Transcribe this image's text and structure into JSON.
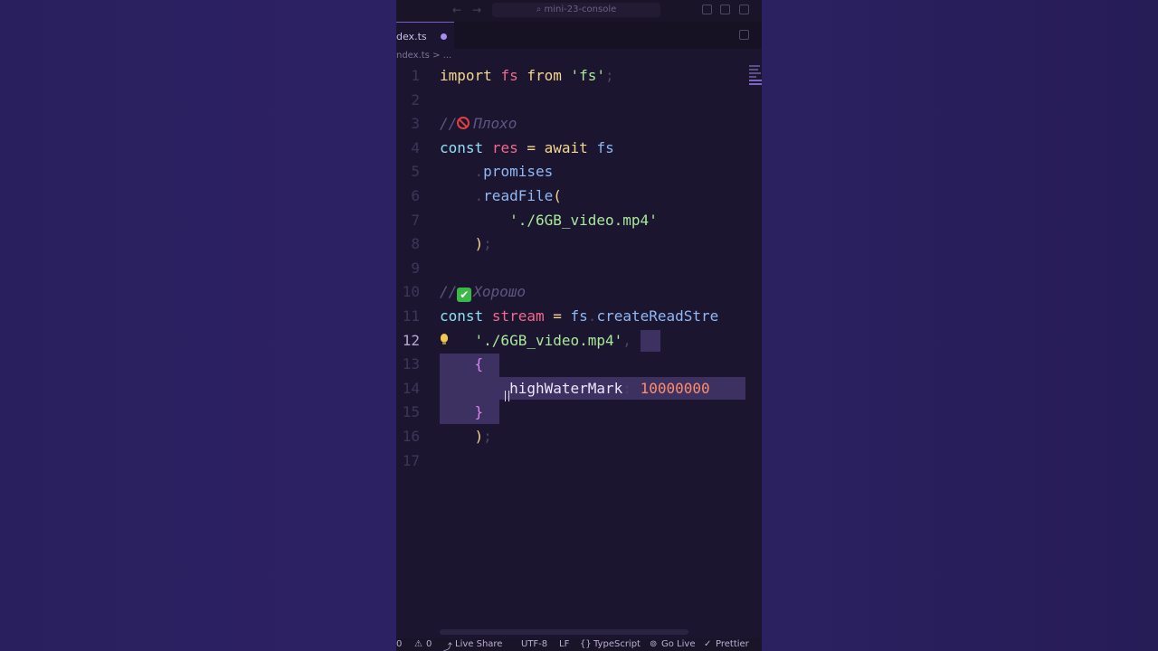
{
  "window": {
    "search_text": "mini-23-console"
  },
  "tab": {
    "label": "dex.ts"
  },
  "breadcrumb": {
    "file": "ndex.ts",
    "sep": ">",
    "more": "..."
  },
  "code": {
    "line_numbers": [
      "1",
      "2",
      "3",
      "4",
      "5",
      "6",
      "7",
      "8",
      "9",
      "10",
      "11",
      "12",
      "13",
      "14",
      "15",
      "16",
      "17"
    ],
    "l1": {
      "kw": "import",
      "name": "fs",
      "from": "from",
      "str": "'fs'",
      "semi": ";"
    },
    "l3": {
      "slashes": "//",
      "text": "Плохо"
    },
    "l4": {
      "kw": "const",
      "var": "res",
      "eq": "=",
      "await": "await",
      "obj": "fs"
    },
    "l5": {
      "dot": ".",
      "prop": "promises"
    },
    "l6": {
      "dot": ".",
      "method": "readFile",
      "paren": "("
    },
    "l7": {
      "str": "'./6GB_video.mp4'"
    },
    "l8": {
      "close": ")",
      "semi": ";"
    },
    "l10": {
      "slashes": "//",
      "text": "Хорошо"
    },
    "l11": {
      "kw": "const",
      "var": "stream",
      "eq": "=",
      "obj": "fs",
      "dot": ".",
      "method": "createReadStre"
    },
    "l12": {
      "str": "'./6GB_video.mp4'",
      "comma": ","
    },
    "l13": {
      "brace": "{"
    },
    "l14": {
      "key": "highWaterMark",
      "colon": ":",
      "num": "10000000"
    },
    "l15": {
      "brace": "}"
    },
    "l16": {
      "close": ")",
      "semi": ";"
    }
  },
  "status": {
    "errors": "0",
    "warnings": "0",
    "live_share": "Live Share",
    "encoding": "UTF-8",
    "eol": "LF",
    "language": "TypeScript",
    "go_live": "Go Live",
    "prettier": "Prettier"
  }
}
